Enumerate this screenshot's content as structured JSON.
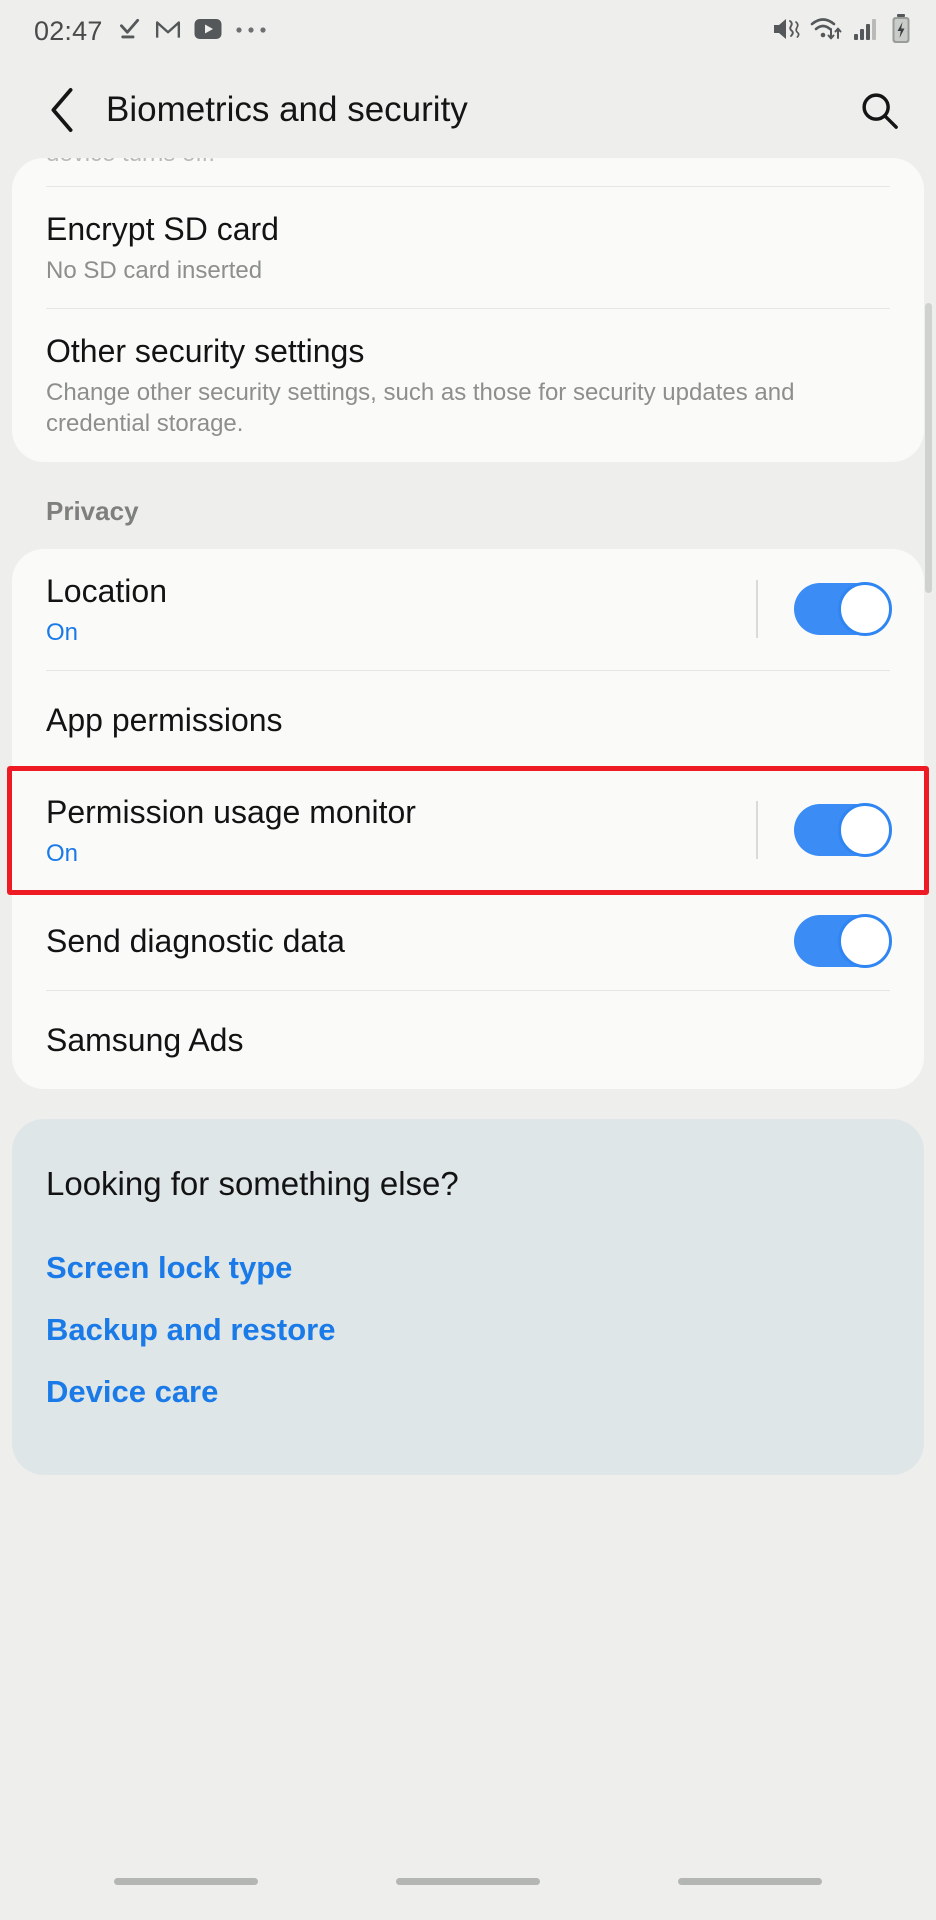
{
  "status_bar": {
    "time": "02:47",
    "left_icons": [
      "download-complete-icon",
      "gmail-icon",
      "youtube-icon",
      "more-notifications-icon"
    ],
    "right_icons": [
      "mute-vibrate-icon",
      "wifi-icon",
      "signal-bars-icon",
      "battery-charging-icon"
    ]
  },
  "app_bar": {
    "back_label": "‹",
    "title": "Biometrics and security",
    "search_label": "search-icon"
  },
  "security_card": {
    "clipped_row_text": "device turns off.",
    "items": [
      {
        "title": "Encrypt SD card",
        "subtitle": "No SD card inserted"
      },
      {
        "title": "Other security settings",
        "subtitle": "Change other security settings, such as those for security updates and credential storage."
      }
    ]
  },
  "privacy_section": {
    "header": "Privacy",
    "items": [
      {
        "title": "Location",
        "subtitle": "On",
        "subtitle_style": "blue",
        "toggle": "on",
        "has_divider": true,
        "highlighted": false
      },
      {
        "title": "App permissions",
        "subtitle": "",
        "toggle": "none",
        "has_divider": false,
        "highlighted": false
      },
      {
        "title": "Permission usage monitor",
        "subtitle": "On",
        "subtitle_style": "blue",
        "toggle": "on",
        "has_divider": true,
        "highlighted": true
      },
      {
        "title": "Send diagnostic data",
        "subtitle": "",
        "toggle": "on",
        "has_divider": false,
        "highlighted": false
      },
      {
        "title": "Samsung Ads",
        "subtitle": "",
        "toggle": "none",
        "has_divider": false,
        "highlighted": false
      }
    ]
  },
  "suggestions": {
    "title": "Looking for something else?",
    "links": [
      "Screen lock type",
      "Backup and restore",
      "Device care"
    ]
  },
  "colors": {
    "accent_blue": "#1a7ae8",
    "toggle_on": "#3b8cf5",
    "highlight_red": "#ee1b24",
    "page_background": "#eeefec",
    "card_background": "#fafbf9",
    "suggest_background": "#dfe6e8"
  },
  "nav_bar": {
    "items": [
      "recents-pill",
      "home-pill",
      "back-pill"
    ]
  }
}
